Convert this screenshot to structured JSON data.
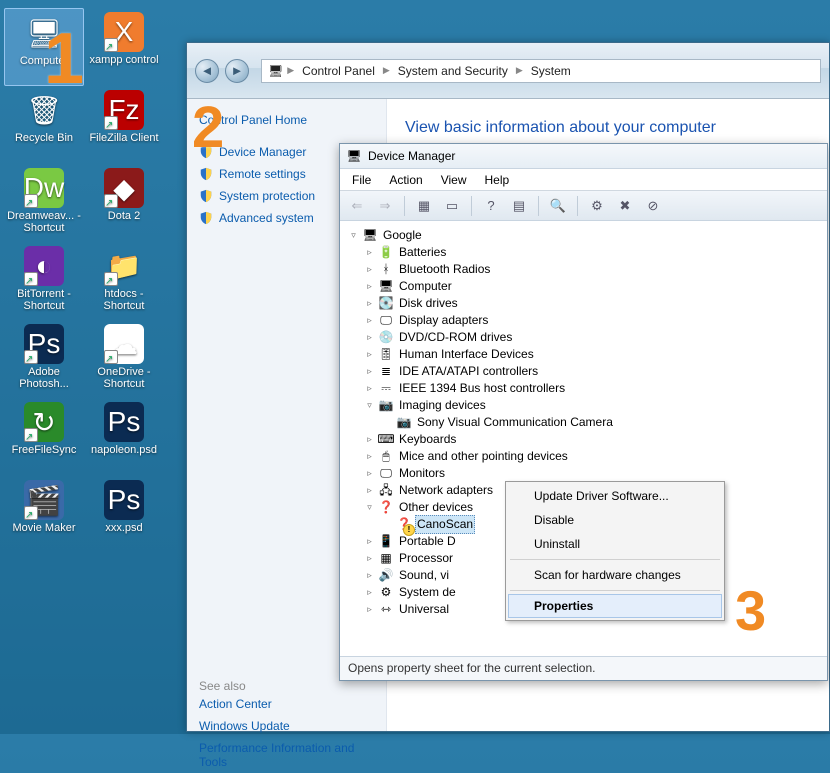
{
  "desktop": {
    "rows": [
      [
        {
          "label": "Computer",
          "icon": "computer-icon",
          "selected": true,
          "shortcut": false
        },
        {
          "label": "xampp control",
          "icon": "xampp-icon",
          "selected": false,
          "shortcut": true
        }
      ],
      [
        {
          "label": "Recycle Bin",
          "icon": "recycle-icon",
          "selected": false,
          "shortcut": false
        },
        {
          "label": "FileZilla Client",
          "icon": "filezilla-icon",
          "selected": false,
          "shortcut": true
        }
      ],
      [
        {
          "label": "Dreamweav... - Shortcut",
          "icon": "dreamweaver-icon",
          "selected": false,
          "shortcut": true
        },
        {
          "label": "Dota 2",
          "icon": "dota-icon",
          "selected": false,
          "shortcut": true
        }
      ],
      [
        {
          "label": "BitTorrent - Shortcut",
          "icon": "bittorrent-icon",
          "selected": false,
          "shortcut": true
        },
        {
          "label": "htdocs - Shortcut",
          "icon": "folder-icon",
          "selected": false,
          "shortcut": true
        }
      ],
      [
        {
          "label": "Adobe Photosh...",
          "icon": "photoshop-icon",
          "selected": false,
          "shortcut": true
        },
        {
          "label": "OneDrive - Shortcut",
          "icon": "onedrive-icon",
          "selected": false,
          "shortcut": true
        }
      ],
      [
        {
          "label": "FreeFileSync",
          "icon": "freefilesync-icon",
          "selected": false,
          "shortcut": true
        },
        {
          "label": "napoleon.psd",
          "icon": "psd-icon",
          "selected": false,
          "shortcut": false
        }
      ],
      [
        {
          "label": "Movie Maker",
          "icon": "moviemaker-icon",
          "selected": false,
          "shortcut": true
        },
        {
          "label": "xxx.psd",
          "icon": "psd-icon",
          "selected": false,
          "shortcut": false
        }
      ]
    ]
  },
  "system_window": {
    "breadcrumbs": [
      "Control Panel",
      "System and Security",
      "System"
    ],
    "sidebar": {
      "home": "Control Panel Home",
      "links": [
        "Device Manager",
        "Remote settings",
        "System protection",
        "Advanced system"
      ]
    },
    "main_heading": "View basic information about your computer",
    "see_also_label": "See also",
    "see_also": [
      "Action Center",
      "Windows Update",
      "Performance Information and Tools"
    ]
  },
  "device_manager": {
    "title": "Device Manager",
    "menu": [
      "File",
      "Action",
      "View",
      "Help"
    ],
    "root": "Google",
    "categories": [
      {
        "label": "Batteries",
        "expanded": false,
        "icon": "battery-icon"
      },
      {
        "label": "Bluetooth Radios",
        "expanded": false,
        "icon": "bluetooth-icon"
      },
      {
        "label": "Computer",
        "expanded": false,
        "icon": "pc-icon"
      },
      {
        "label": "Disk drives",
        "expanded": false,
        "icon": "disk-icon"
      },
      {
        "label": "Display adapters",
        "expanded": false,
        "icon": "display-icon"
      },
      {
        "label": "DVD/CD-ROM drives",
        "expanded": false,
        "icon": "cd-icon"
      },
      {
        "label": "Human Interface Devices",
        "expanded": false,
        "icon": "hid-icon"
      },
      {
        "label": "IDE ATA/ATAPI controllers",
        "expanded": false,
        "icon": "ide-icon"
      },
      {
        "label": "IEEE 1394 Bus host controllers",
        "expanded": false,
        "icon": "ieee-icon"
      },
      {
        "label": "Imaging devices",
        "expanded": true,
        "icon": "camera-icon",
        "children": [
          {
            "label": "Sony Visual Communication Camera",
            "icon": "camera-icon"
          }
        ]
      },
      {
        "label": "Keyboards",
        "expanded": false,
        "icon": "keyboard-icon"
      },
      {
        "label": "Mice and other pointing devices",
        "expanded": false,
        "icon": "mouse-icon"
      },
      {
        "label": "Monitors",
        "expanded": false,
        "icon": "monitor-icon"
      },
      {
        "label": "Network adapters",
        "expanded": false,
        "icon": "network-icon"
      },
      {
        "label": "Other devices",
        "expanded": true,
        "icon": "other-icon",
        "children": [
          {
            "label": "CanoScan",
            "icon": "unknown-icon",
            "warning": true,
            "selected": true
          }
        ]
      },
      {
        "label": "Portable D",
        "expanded": false,
        "icon": "portable-icon",
        "truncated": true
      },
      {
        "label": "Processor",
        "expanded": false,
        "icon": "cpu-icon",
        "truncated": true
      },
      {
        "label": "Sound, vi",
        "expanded": false,
        "icon": "sound-icon",
        "truncated": true
      },
      {
        "label": "System de",
        "expanded": false,
        "icon": "system-icon",
        "truncated": true
      },
      {
        "label": "Universal",
        "expanded": false,
        "icon": "usb-icon",
        "truncated": true
      }
    ],
    "status_bar": "Opens property sheet for the current selection."
  },
  "context_menu": {
    "items": [
      {
        "label": "Update Driver Software...",
        "type": "item"
      },
      {
        "label": "Disable",
        "type": "item"
      },
      {
        "label": "Uninstall",
        "type": "item"
      },
      {
        "type": "sep"
      },
      {
        "label": "Scan for hardware changes",
        "type": "item"
      },
      {
        "type": "sep"
      },
      {
        "label": "Properties",
        "type": "item",
        "highlighted": true
      }
    ]
  },
  "step_numbers": {
    "n1": "1",
    "n2": "2",
    "n3": "3"
  }
}
